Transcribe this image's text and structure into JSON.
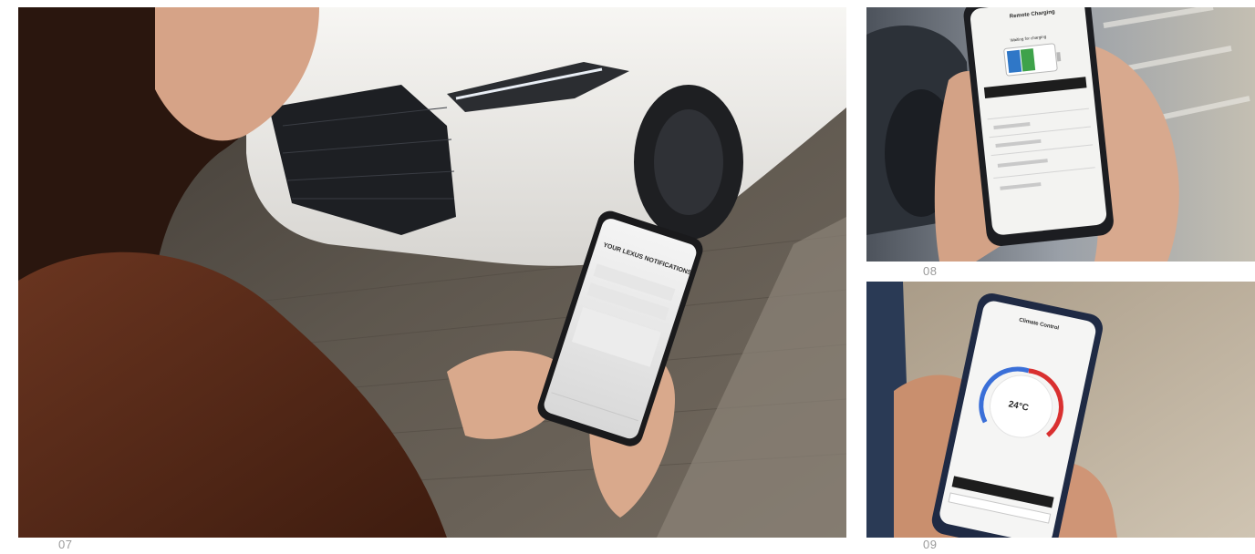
{
  "photos": [
    {
      "caption": "07",
      "subject": "Woman holding smartphone beside white car at night",
      "screen_title": "YOUR LEXUS NOTIFICATIONS",
      "palette": {
        "car": "#f1f0ed",
        "grille": "#1d1f23",
        "ground": "#6b6359",
        "coat": "#5a2a16",
        "hair": "#2a160e",
        "skin": "#d9a98c"
      }
    },
    {
      "caption": "08",
      "subject": "Hands holding phone showing remote charging screen",
      "screen_title": "Remote Charging",
      "screen_status": "Waiting for charging",
      "palette": {
        "battery_green": "#3ea24a",
        "battery_blue": "#2f77c7",
        "bg": "#8a8f98"
      }
    },
    {
      "caption": "09",
      "subject": "Hands holding phone showing climate control dial",
      "screen_title": "Climate Control",
      "screen_temperature": "24°C",
      "palette": {
        "dial_blue": "#3a6fd8",
        "dial_red": "#d93030",
        "bg": "#b7a892"
      }
    }
  ]
}
